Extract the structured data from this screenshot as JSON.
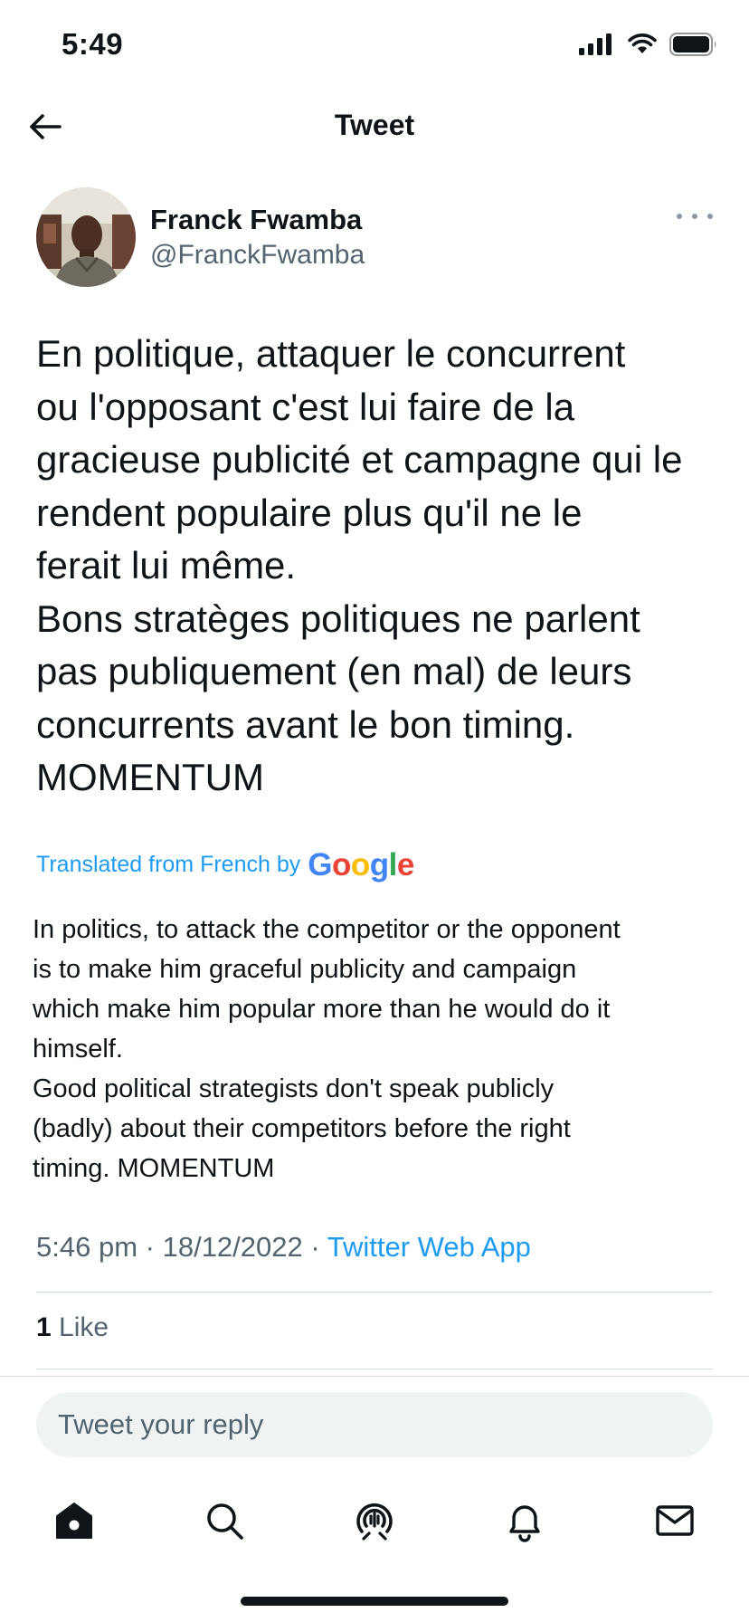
{
  "status_bar": {
    "time": "5:49"
  },
  "header": {
    "title": "Tweet"
  },
  "author": {
    "name": "Franck Fwamba",
    "handle": "@FranckFwamba"
  },
  "tweet": {
    "text": "En politique, attaquer le concurrent\nou l'opposant c'est lui faire de la\ngracieuse publicité et campagne qui le\nrendent populaire plus qu'il ne le\nferait lui même.\nBons stratèges politiques ne parlent\npas publiquement (en mal) de leurs\nconcurrents avant le bon timing.\nMOMENTUM",
    "translated_label": "Translated from French by",
    "translation_brand": "Google",
    "translation": "In politics, to attack the competitor or the opponent\nis to make him graceful publicity and campaign\nwhich make him popular more than he would do it\nhimself.\nGood political strategists don't speak publicly\n(badly) about their competitors before the right\ntiming. MOMENTUM",
    "time": "5:46 pm",
    "separator": "·",
    "date": "18/12/2022",
    "source": "Twitter Web App",
    "like_count": "1",
    "like_label": "Like"
  },
  "reply": {
    "placeholder": "Tweet your reply"
  },
  "tab_bar": {
    "items": [
      {
        "name": "home",
        "icon": "home-icon"
      },
      {
        "name": "search",
        "icon": "search-icon"
      },
      {
        "name": "spaces",
        "icon": "spaces-icon"
      },
      {
        "name": "notifications",
        "icon": "bell-icon"
      },
      {
        "name": "messages",
        "icon": "mail-icon"
      }
    ]
  },
  "colors": {
    "accent": "#1d9bf0",
    "text": "#0f1419",
    "secondary_text": "#536471",
    "divider": "#cfd9de",
    "input_bg": "#eff3f4",
    "google_blue": "#4285f4",
    "google_red": "#ea4335",
    "google_yellow": "#fbbc05",
    "google_green": "#34a853"
  }
}
